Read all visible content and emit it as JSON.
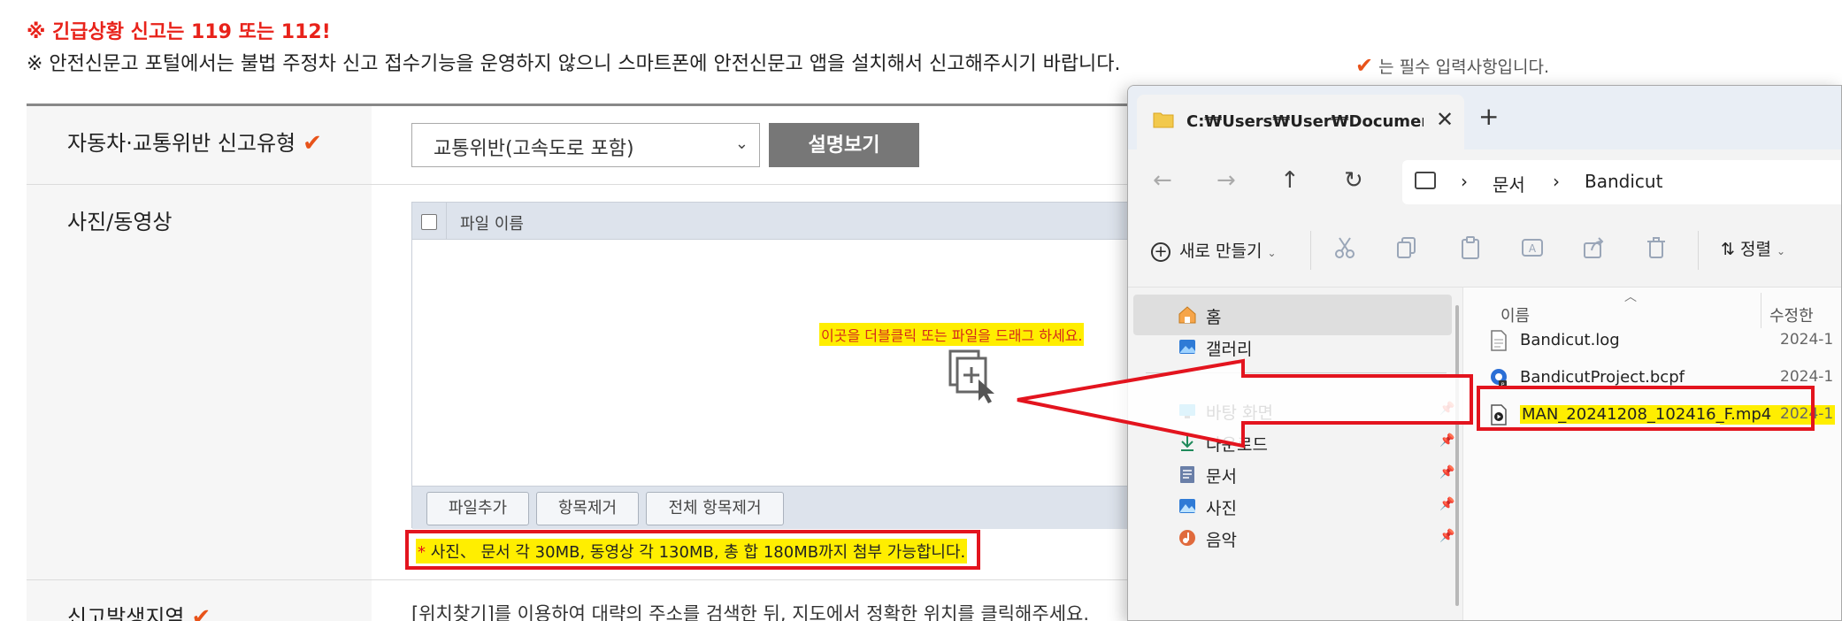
{
  "notice": {
    "emergency": "※ 긴급상황 신고는 119 또는 112!",
    "app_notice": "※ 안전신문고 포털에서는 불법 주정차 신고 접수기능을 운영하지 않으니 스마트폰에 안전신문고 앱을 설치해서 신고해주시기 바랍니다."
  },
  "required_note": {
    "check": "✔",
    "text": "는 필수 입력사항입니다."
  },
  "form": {
    "report_type": {
      "label": "자동차·교통위반 신고유형",
      "check": "✔",
      "selected": "교통위반(고속도로 포함)",
      "caret": "⌄",
      "desc_button": "설명보기"
    },
    "media": {
      "label": "사진/동영상",
      "column_file_name": "파일 이름",
      "drop_hint": "이곳을 더블클릭 또는 파일을 드래그 하세요.",
      "buttons": {
        "add": "파일추가",
        "remove": "항목제거",
        "remove_all": "전체 항목제거"
      },
      "limit_star": "*",
      "limit_text": " 사진、 문서 각 30MB, 동영상 각 130MB, 총 합 180MB까지 첨부 가능합니다."
    },
    "location": {
      "label": "신고발생지역",
      "check": "✔",
      "guide": "[위치찾기]를 이용하여 대략의 주소를 검색한 뒤, 지도에서 정확한 위치를 클릭해주세요."
    }
  },
  "explorer": {
    "tab_title": "C:₩Users₩User₩Documents₩Bandicut",
    "tab_close": "✕",
    "new_tab": "+",
    "nav": {
      "back": "←",
      "forward": "→",
      "up": "↑",
      "refresh": "↻"
    },
    "breadcrumb": [
      "문서",
      "Bandicut"
    ],
    "crumb_sep": "›",
    "toolbar": {
      "new_label": "새로 만들기",
      "new_plus": "+",
      "dropdown": "⌄",
      "sort_label": "정렬"
    },
    "sidebar": [
      {
        "label": "홈",
        "icon": "home-icon",
        "pinned": false
      },
      {
        "label": "갤러리",
        "icon": "gallery-icon",
        "pinned": false
      },
      {
        "label": "바탕 화면",
        "icon": "desktop-icon",
        "pinned": true
      },
      {
        "label": "다운로드",
        "icon": "download-icon",
        "pinned": true
      },
      {
        "label": "문서",
        "icon": "document-icon",
        "pinned": true
      },
      {
        "label": "사진",
        "icon": "pictures-icon",
        "pinned": true
      },
      {
        "label": "음악",
        "icon": "music-icon",
        "pinned": true
      }
    ],
    "columns": {
      "name": "이름",
      "modified": "수정한"
    },
    "files": [
      {
        "name": "Bandicut.log",
        "date": "2024-1",
        "icon": "text-file-icon"
      },
      {
        "name": "BandicutProject.bcpf",
        "date": "2024-1",
        "icon": "project-file-icon"
      },
      {
        "name": "MAN_20241208_102416_F.mp4",
        "date": "2024-1",
        "icon": "video-file-icon"
      }
    ]
  },
  "colors": {
    "emergency_red": "#e8221a",
    "check_orange": "#e8531a",
    "highlight_yellow": "#ffee00",
    "annotation_red": "#e3141e"
  }
}
